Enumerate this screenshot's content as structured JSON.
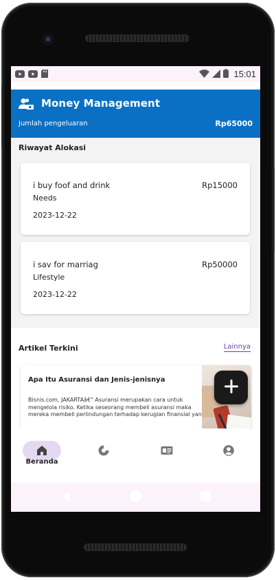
{
  "status_bar": {
    "time": "15:01"
  },
  "header": {
    "title": "Money Management",
    "total_label": "Jumlah pengeluaran",
    "total_value": "Rp65000",
    "color": "#0a70c4"
  },
  "history": {
    "title": "Riwayat Alokasi",
    "items": [
      {
        "description": "i buy foof and drink",
        "amount": "Rp15000",
        "category": "Needs",
        "date": "2023-12-22"
      },
      {
        "description": "i sav for marriag",
        "amount": "Rp50000",
        "category": "Lifestyle",
        "date": "2023-12-22"
      }
    ]
  },
  "articles": {
    "title": "Artikel Terkini",
    "more_label": "Lainnya",
    "items": [
      {
        "title": "Apa Itu Asuransi dan Jenis-jenisnya",
        "excerpt": "Bisnis.com, JAKARTAâ€\" Asuransi merupakan cara untuk mengelola risiko. Ketika seseorang membeli asuransi maka mereka membeli perlindungan terhadap kerugian finansial yan..."
      }
    ]
  },
  "bottom_nav": {
    "items": [
      {
        "label": "Beranda",
        "icon": "home-icon",
        "active": true
      },
      {
        "label": "",
        "icon": "pie-chart-icon",
        "active": false
      },
      {
        "label": "",
        "icon": "article-icon",
        "active": false
      },
      {
        "label": "",
        "icon": "profile-icon",
        "active": false
      }
    ]
  },
  "colors": {
    "accent": "#0a70c4",
    "active_pill": "#e5d9f2",
    "link": "#6b3fa0"
  }
}
